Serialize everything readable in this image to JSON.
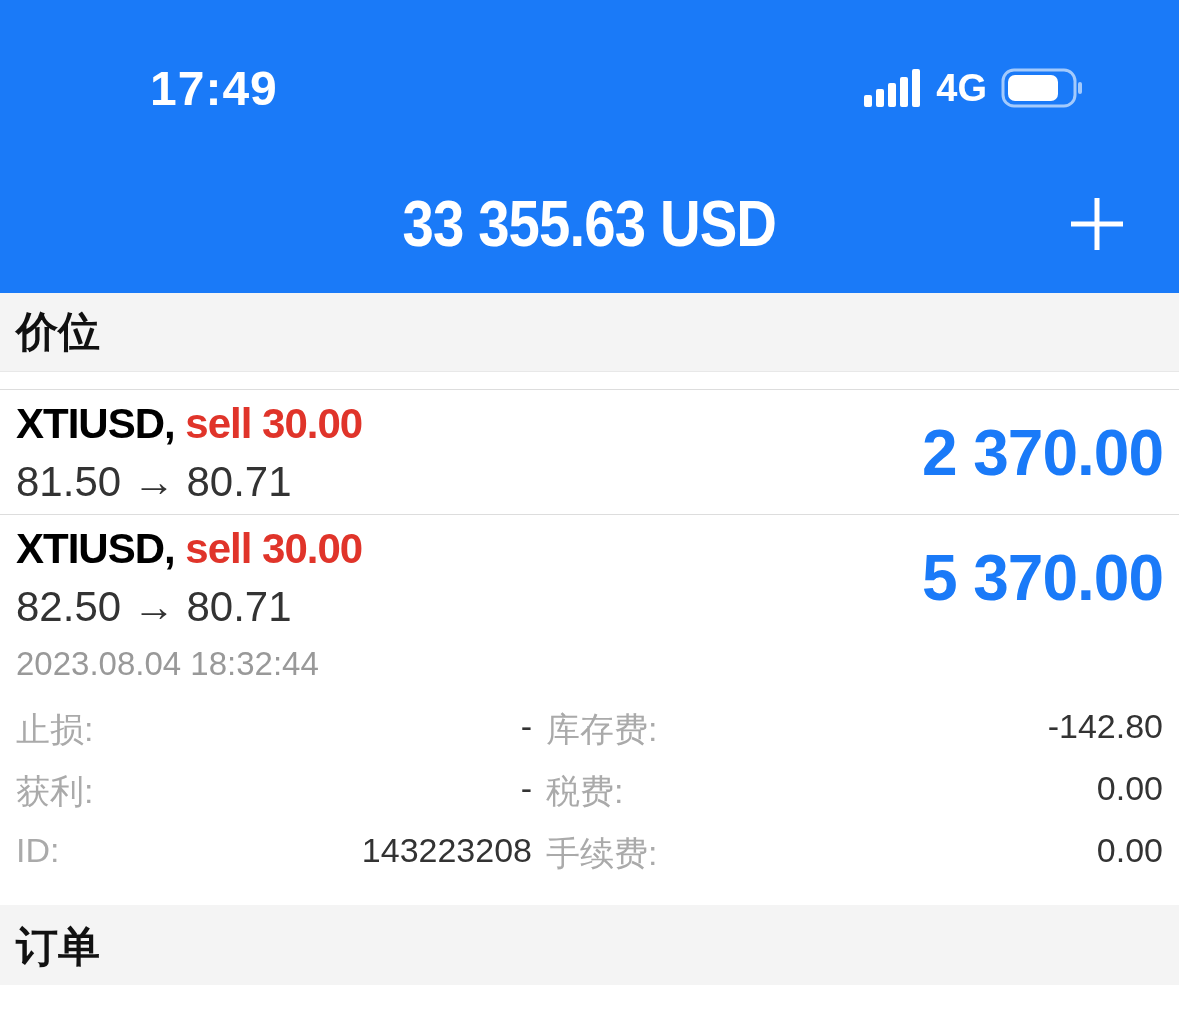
{
  "status_bar": {
    "time": "17:49",
    "network": "4G"
  },
  "header": {
    "balance": "33 355.63 USD"
  },
  "positions": {
    "title": "价位",
    "items": [
      {
        "symbol": "XTIUSD,",
        "side": "sell",
        "volume": "30.00",
        "prices": "81.50 → 80.71",
        "profit": "2 370.00",
        "expanded": false
      },
      {
        "symbol": "XTIUSD,",
        "side": "sell",
        "volume": "30.00",
        "prices": "82.50 → 80.71",
        "profit": "5 370.00",
        "expanded": true,
        "opened": "2023.08.04 18:32:44",
        "detail_rows": [
          [
            {
              "label": "止损:",
              "value": "-"
            },
            {
              "label": "库存费:",
              "value": "-142.80"
            }
          ],
          [
            {
              "label": "获利:",
              "value": "-"
            },
            {
              "label": "税费:",
              "value": "0.00"
            }
          ],
          [
            {
              "label": "ID:",
              "value": "143223208"
            },
            {
              "label": "手续费:",
              "value": "0.00"
            }
          ]
        ]
      }
    ]
  },
  "orders": {
    "title": "订单"
  }
}
